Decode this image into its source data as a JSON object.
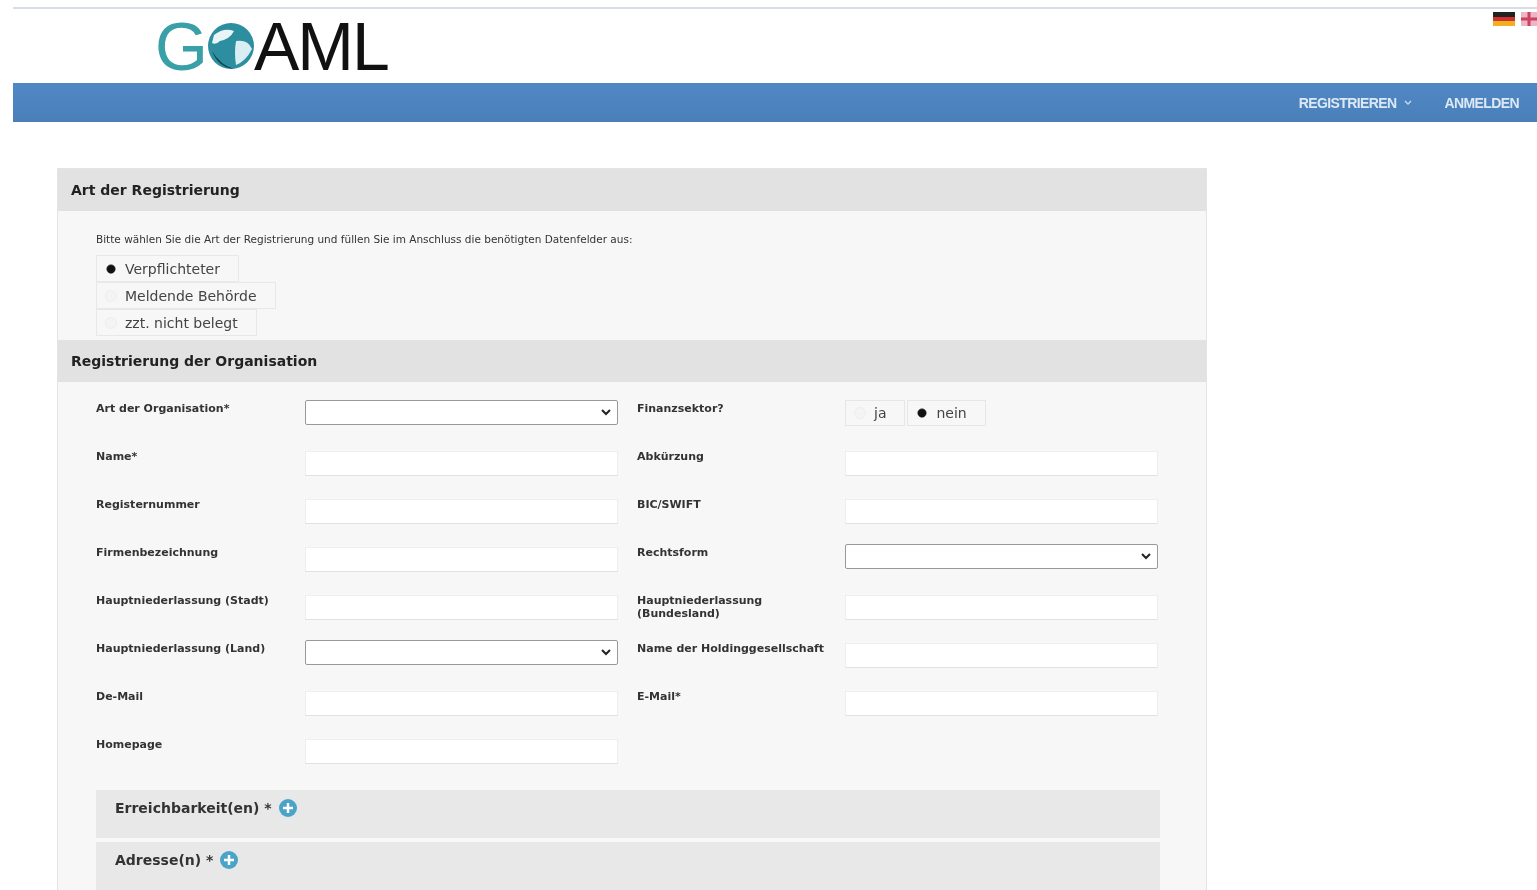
{
  "logo": {
    "before": "G",
    "after": "AML"
  },
  "nav": [
    {
      "label": "REGISTRIEREN",
      "kind": "menu"
    },
    {
      "label": "ANMELDEN",
      "kind": "link"
    }
  ],
  "registration_type": {
    "title": "Art der Registrierung",
    "instruction": "Bitte wählen Sie die Art der Registrierung und füllen Sie im Anschluss die benötigten Datenfelder aus:",
    "options": [
      {
        "label": "Verpflichteter",
        "selected": true
      },
      {
        "label": "Meldende Behörde",
        "selected": false
      },
      {
        "label": "zzt. nicht belegt",
        "selected": false
      }
    ]
  },
  "organisation": {
    "title": "Registrierung der Organisation",
    "rows": [
      {
        "left": {
          "label": "Art der Organisation*",
          "kind": "select"
        },
        "right": {
          "label": "Finanzsektor?",
          "kind": "radio",
          "options": [
            {
              "label": "ja",
              "selected": false
            },
            {
              "label": "nein",
              "selected": true
            }
          ]
        }
      },
      {
        "left": {
          "label": "Name*",
          "kind": "text"
        },
        "right": {
          "label": "Abkürzung",
          "kind": "text"
        }
      },
      {
        "left": {
          "label": "Registernummer",
          "kind": "text"
        },
        "right": {
          "label": "BIC/SWIFT",
          "kind": "text"
        }
      },
      {
        "left": {
          "label": "Firmenbezeichnung",
          "kind": "text"
        },
        "right": {
          "label": "Rechtsform",
          "kind": "select"
        }
      },
      {
        "left": {
          "label": "Hauptniederlassung (Stadt)",
          "kind": "text"
        },
        "right": {
          "label": "Hauptniederlassung (Bundesland)",
          "kind": "text"
        }
      },
      {
        "left": {
          "label": "Hauptniederlassung (Land)",
          "kind": "select"
        },
        "right": {
          "label": "Name der Holdinggesellschaft",
          "kind": "text"
        }
      },
      {
        "left": {
          "label": "De-Mail",
          "kind": "text"
        },
        "right": {
          "label": "E-Mail*",
          "kind": "text"
        }
      },
      {
        "left": {
          "label": "Homepage",
          "kind": "text"
        }
      }
    ],
    "subsections": [
      {
        "title": "Erreichbarkeit(en) *"
      },
      {
        "title": "Adresse(n) *"
      }
    ]
  }
}
